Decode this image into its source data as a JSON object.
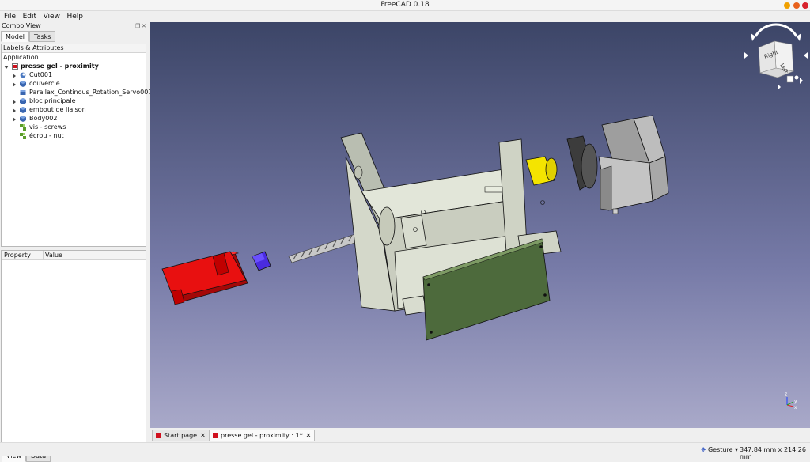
{
  "window": {
    "title": "FreeCAD 0.18",
    "controls": [
      {
        "name": "minimize",
        "color": "#f0a000"
      },
      {
        "name": "maximize",
        "color": "#e8601c"
      },
      {
        "name": "close",
        "color": "#d8222b"
      }
    ]
  },
  "menu": {
    "items": [
      {
        "label": "File"
      },
      {
        "label": "Edit"
      },
      {
        "label": "View"
      },
      {
        "label": "Help"
      }
    ]
  },
  "combo_view": {
    "title": "Combo View",
    "tabs": [
      {
        "label": "Model",
        "active": true
      },
      {
        "label": "Tasks",
        "active": false
      }
    ],
    "tree_header": "Labels & Attributes",
    "root": "Application",
    "document": "presse gel - proximity",
    "items": [
      {
        "label": "Cut001",
        "expander": true,
        "icon": "cut-icon",
        "icon_color": "#4a78c0"
      },
      {
        "label": "couvercle",
        "expander": true,
        "icon": "body-icon",
        "icon_color": "#3a66b0"
      },
      {
        "label": "Parallax_Continous_Rotation_Servo001",
        "expander": false,
        "icon": "part-icon",
        "icon_color": "#3a66b0"
      },
      {
        "label": "bloc principale",
        "expander": true,
        "icon": "body-icon",
        "icon_color": "#3a66b0"
      },
      {
        "label": "embout de liaison",
        "expander": true,
        "icon": "body-icon",
        "icon_color": "#3a66b0"
      },
      {
        "label": "Body002",
        "expander": true,
        "icon": "body-icon",
        "icon_color": "#3a66b0"
      },
      {
        "label": "vis - screws",
        "expander": false,
        "icon": "group-icon",
        "icon_color": "#5a9c2a"
      },
      {
        "label": "écrou - nut",
        "expander": false,
        "icon": "group-icon",
        "icon_color": "#5a9c2a"
      }
    ],
    "property_header": {
      "property": "Property",
      "value": "Value"
    },
    "bottom_tabs": [
      {
        "label": "View",
        "active": true
      },
      {
        "label": "Data",
        "active": false
      }
    ]
  },
  "viewport": {
    "nav_cube": {
      "faces": [
        "Right",
        "Left"
      ]
    },
    "axis_labels": [
      "x",
      "y",
      "z"
    ],
    "background_top": "#3c4567",
    "background_bottom": "#a9a9c9"
  },
  "document_tabs": [
    {
      "label": "Start page",
      "active": false
    },
    {
      "label": "presse gel - proximity : 1*",
      "active": true
    }
  ],
  "status": {
    "navigation": "Gesture",
    "dimensions": "347.84 mm x 214.26 mm"
  },
  "colors": {
    "part_red": "#e81010",
    "part_blue": "#4a2be0",
    "part_yellow": "#f4e400",
    "part_green": "#4d6a3c",
    "part_grey": "#cfcfcf",
    "housing": "#d8dccd"
  }
}
